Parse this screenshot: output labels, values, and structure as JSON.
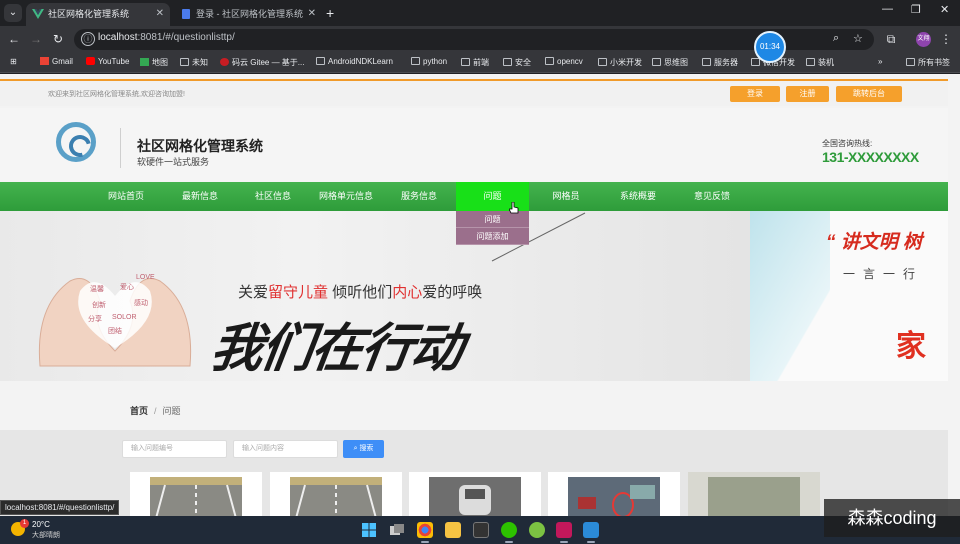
{
  "browser": {
    "tabs": [
      {
        "title": "社区网格化管理系统",
        "active": true
      },
      {
        "title": "登录 - 社区网格化管理系统",
        "active": false
      }
    ],
    "url_host": "localhost",
    "url_path": ":8081/#/questionlisttp/",
    "timer": "01:34",
    "profile_initials": "文翔",
    "bookmarks": [
      "Gmail",
      "YouTube",
      "地图",
      "未知",
      "码云 Gitee — 基于...",
      "AndroidNDKLearn",
      "python",
      "前端",
      "安全",
      "opencv",
      "小米开发",
      "思维图",
      "服务器",
      "微信开发",
      "装机"
    ],
    "bookmarks_overflow": "»",
    "all_bookmarks": "所有书签"
  },
  "site": {
    "welcome": "欢迎来到社区网格化管理系统,欢迎咨询加盟!",
    "top_buttons": [
      "登录",
      "注册",
      "跳转后台"
    ],
    "title": "社区网格化管理系统",
    "subtitle": "软硬件一站式服务",
    "hotline_label": "全国咨询热线:",
    "hotline_number": "131-XXXXXXXX",
    "nav": [
      "网站首页",
      "最新信息",
      "社区信息",
      "网格单元信息",
      "服务信息",
      "问题",
      "网格员",
      "系统概要",
      "意见反馈"
    ],
    "nav_active": "问题",
    "dropdown": [
      "问题",
      "问题添加"
    ],
    "banner": {
      "slogan_line1_parts": [
        "关爱",
        "留守儿童",
        " 倾听他们",
        "内心",
        "爱的呼唤"
      ],
      "slogan_line2": "我们在行动",
      "heart_words": [
        "温馨",
        "爱心",
        "LOVE",
        "创新",
        "感动",
        "分享",
        "SOLOR",
        "团结"
      ],
      "right_quote": "“ 讲文明 树",
      "right_sub": "一言一行",
      "right_big": "家"
    },
    "breadcrumb": {
      "home": "首页",
      "separator": "/",
      "current": "问题"
    },
    "search": {
      "placeholder_number": "输入问题编号",
      "placeholder_content": "输入问题内容",
      "button": "搜索"
    }
  },
  "status_url": "localhost:8081/#/questionlisttp/",
  "taskbar": {
    "temperature": "20°C",
    "condition": "大部晴朗",
    "badge": "1"
  },
  "watermark": "森森coding",
  "colors": {
    "nav_green": "#2e9c3a",
    "nav_active": "#18e018",
    "top_orange": "#f5a02c",
    "dropdown": "#9b6f8c",
    "search_blue": "#3e8ef7"
  }
}
